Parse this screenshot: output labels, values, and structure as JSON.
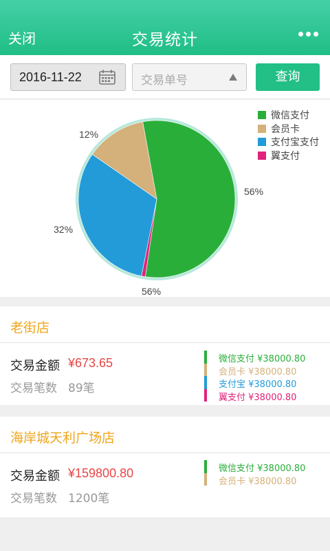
{
  "header": {
    "close_label": "关闭",
    "title": "交易统计",
    "more_icon": "more-dots-icon"
  },
  "filter": {
    "date_value": "2016-11-22",
    "calendar_icon": "calendar-icon",
    "order_placeholder": "交易单号",
    "dropdown_icon": "triangle-up-icon",
    "query_label": "查询"
  },
  "colors": {
    "accent": "#22bf86",
    "wechat": "#2aae3a",
    "member": "#d4b07a",
    "alipay": "#229bd8",
    "yipay": "#e0237a",
    "store_name": "#f0a51a",
    "amount": "#e84545"
  },
  "chart_data": {
    "type": "pie",
    "legend_position": "top-right",
    "legend": [
      "微信支付",
      "会员卡",
      "支付宝支付",
      "翼支付"
    ],
    "slices": [
      {
        "name": "微信支付",
        "value": 55.2,
        "label": "56%",
        "color": "#2aae3a"
      },
      {
        "name": "翼支付",
        "value": 0.8,
        "label": "56%",
        "color": "#e0237a"
      },
      {
        "name": "支付宝支付",
        "value": 31.5,
        "label": "32%",
        "color": "#229bd8"
      },
      {
        "name": "会员卡",
        "value": 12.5,
        "label": "12%",
        "color": "#d4b07a"
      }
    ]
  },
  "stores": [
    {
      "name": "老街店",
      "amount_label": "交易金额",
      "amount": "¥673.65",
      "count_label": "交易笔数",
      "count": "89笔",
      "breakdown": [
        {
          "text": "微信支付 ¥38000.80",
          "color": "#2aae3a"
        },
        {
          "text": "会员卡 ¥38000.80",
          "color": "#d4b07a"
        },
        {
          "text": "支付宝 ¥38000.80",
          "color": "#229bd8"
        },
        {
          "text": "翼支付 ¥38000.80",
          "color": "#e0237a"
        }
      ]
    },
    {
      "name": "海岸城天利广场店",
      "amount_label": "交易金额",
      "amount": "¥159800.80",
      "count_label": "交易笔数",
      "count": "1200笔",
      "breakdown": [
        {
          "text": "微信支付 ¥38000.80",
          "color": "#2aae3a"
        },
        {
          "text": "会员卡 ¥38000.80",
          "color": "#d4b07a"
        }
      ]
    }
  ]
}
